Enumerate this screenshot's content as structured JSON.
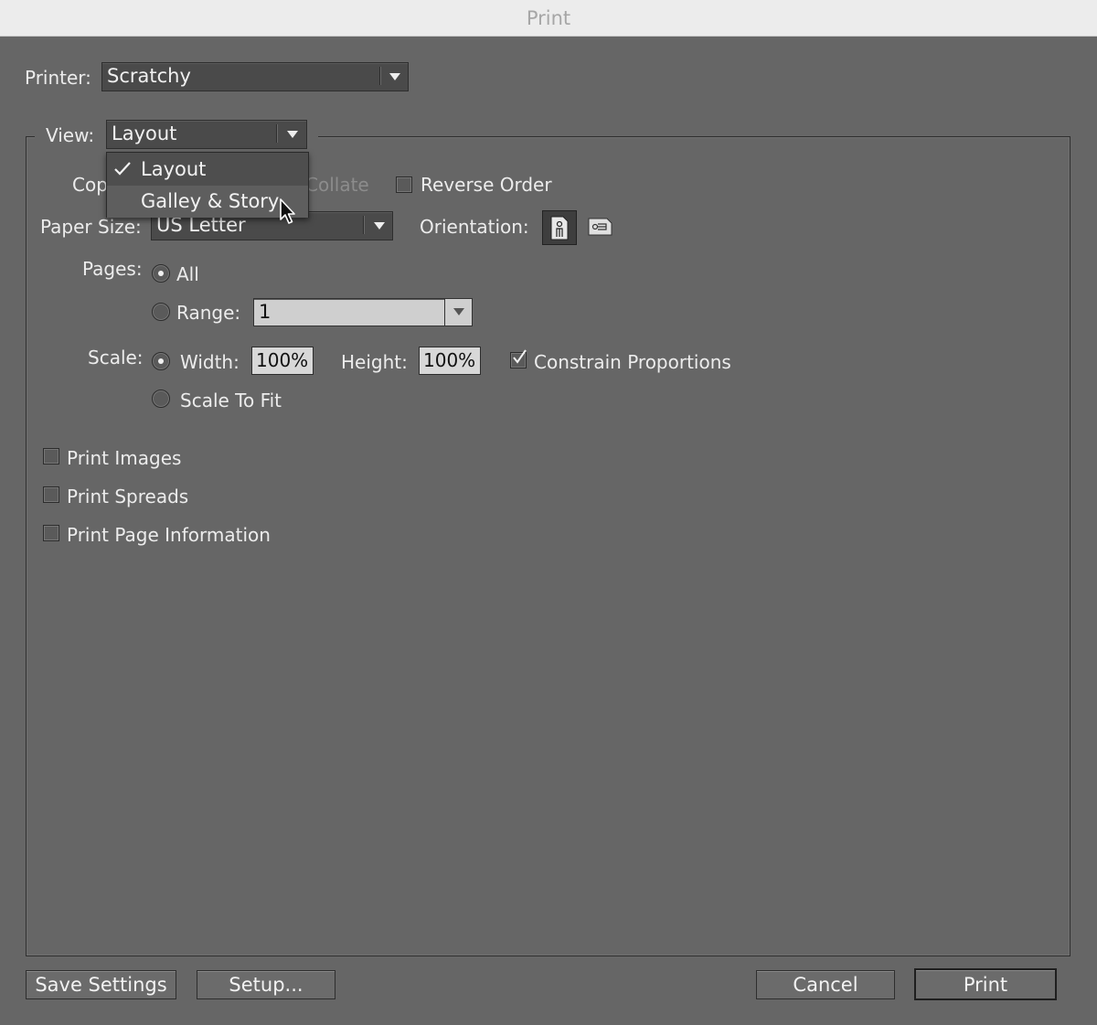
{
  "window": {
    "title": "Print"
  },
  "printer": {
    "label": "Printer:",
    "value": "Scratchy"
  },
  "view": {
    "label": "View:",
    "value": "Layout",
    "menu": [
      {
        "label": "Layout",
        "checked": true
      },
      {
        "label": "Galley & Story",
        "hovered": true
      }
    ]
  },
  "copies": {
    "label_partial": "Cop",
    "collate_partial": "Collate",
    "reverse_order_label": "Reverse Order",
    "reverse_order_checked": false
  },
  "paper": {
    "label": "Paper Size:",
    "value": "US Letter"
  },
  "orientation": {
    "label": "Orientation:",
    "selected": "portrait",
    "icons": [
      "portrait-orientation-icon",
      "landscape-orientation-icon"
    ]
  },
  "pages": {
    "label": "Pages:",
    "all_label": "All",
    "range_label": "Range:",
    "range_value": "1",
    "selected": "all"
  },
  "scale": {
    "label": "Scale:",
    "width_label": "Width:",
    "width_value": "100%",
    "height_label": "Height:",
    "height_value": "100%",
    "constrain_label": "Constrain Proportions",
    "constrain_checked": true,
    "fit_label": "Scale To Fit",
    "selected": "width"
  },
  "options": [
    {
      "label": "Print Images",
      "checked": false
    },
    {
      "label": "Print Spreads",
      "checked": false
    },
    {
      "label": "Print Page Information",
      "checked": false
    }
  ],
  "buttons": {
    "save_settings": "Save Settings",
    "setup": "Setup...",
    "cancel": "Cancel",
    "print": "Print"
  }
}
